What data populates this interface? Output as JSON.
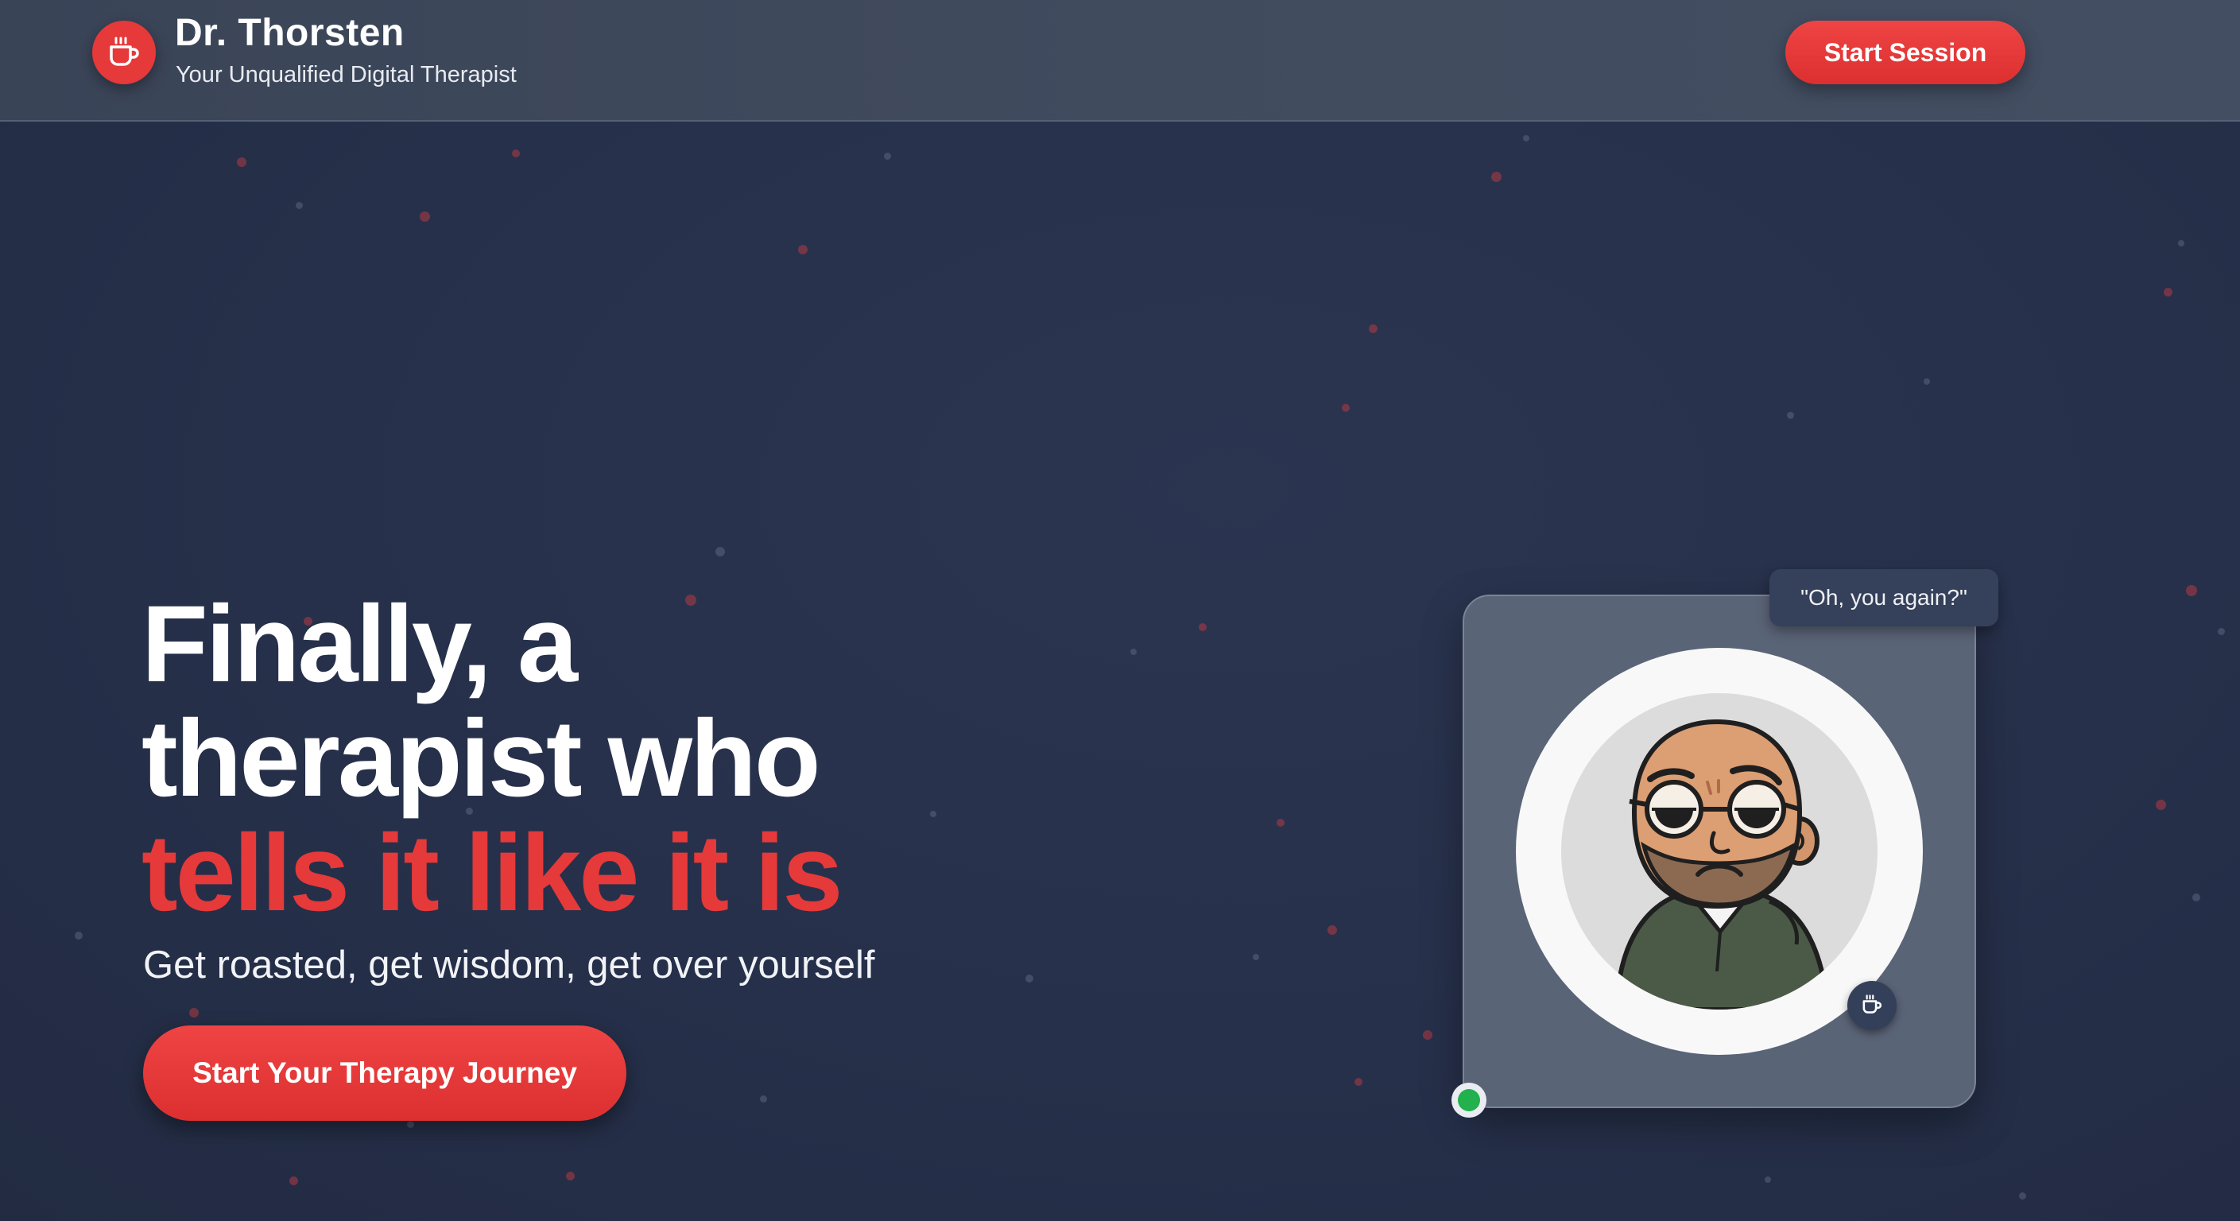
{
  "header": {
    "brand_name": "Dr. Thorsten",
    "tagline": "Your Unqualified Digital Therapist",
    "logo_icon": "coffee-cup-icon",
    "cta_label": "Start Session"
  },
  "hero": {
    "line1": "Finally, a",
    "line2": "therapist who",
    "line3": "tells it like it is",
    "subtitle": "Get roasted, get wisdom, get over yourself",
    "cta_label": "Start Your Therapy Journey"
  },
  "avatar_card": {
    "speech_bubble": "\"Oh, you again?\"",
    "avatar_icon": "cartoon-therapist-avatar",
    "badge_icon": "coffee-cup-icon",
    "status": "online"
  },
  "colors": {
    "accent": "#e5393a",
    "background": "#28324a",
    "header": "#3e4859",
    "status_online": "#22b14c"
  }
}
